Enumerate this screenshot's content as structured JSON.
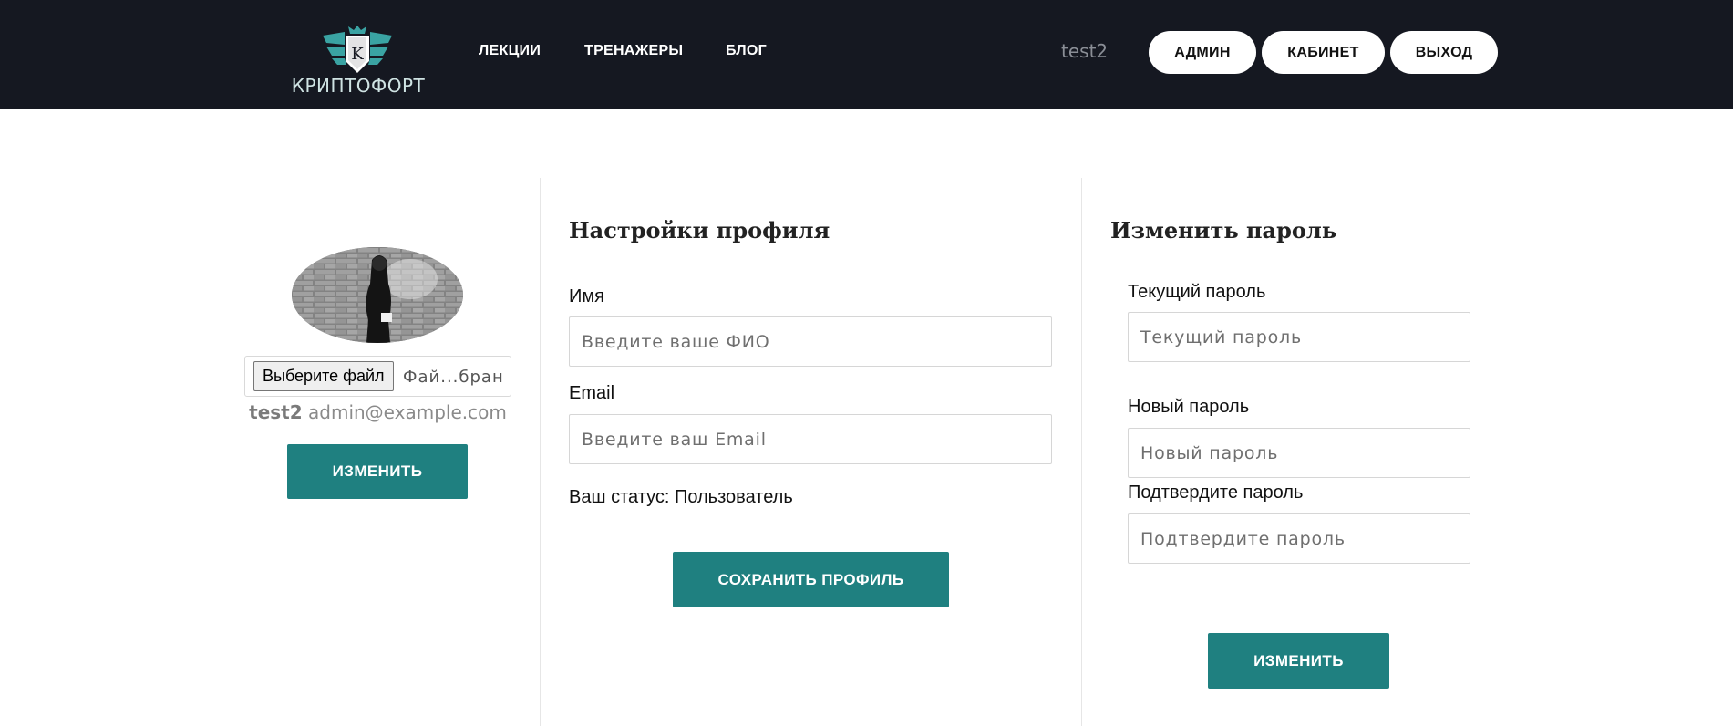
{
  "header": {
    "logo_text": "КРИПТОФОРТ",
    "nav": [
      "ЛЕКЦИИ",
      "ТРЕНАЖЕРЫ",
      "БЛОГ"
    ],
    "username": "test2",
    "buttons": {
      "admin": "АДМИН",
      "cabinet": "КАБИНЕТ",
      "logout": "ВЫХОД"
    }
  },
  "profile_card": {
    "file_button": "Выберите файл",
    "file_name": "Фай...бран",
    "username": "test2",
    "email": "admin@example.com",
    "change_button": "ИЗМЕНИТЬ"
  },
  "profile_settings": {
    "title": "Настройки профиля",
    "name_label": "Имя",
    "name_placeholder": "Введите ваше ФИО",
    "email_label": "Email",
    "email_placeholder": "Введите ваш Email",
    "status_text": "Ваш статус: Пользователь",
    "save_button": "СОХРАНИТЬ ПРОФИЛЬ"
  },
  "change_password": {
    "title": "Изменить пароль",
    "current_label": "Текущий пароль",
    "current_placeholder": "Текущий пароль",
    "new_label": "Новый пароль",
    "new_placeholder": "Новый пароль",
    "confirm_label": "Подтвердите пароль",
    "confirm_placeholder": "Подтвердите пароль",
    "submit_button": "ИЗМЕНИТЬ"
  },
  "colors": {
    "header_bg": "#151821",
    "accent": "#1f8080",
    "logo_teal": "#3aa3a3"
  }
}
